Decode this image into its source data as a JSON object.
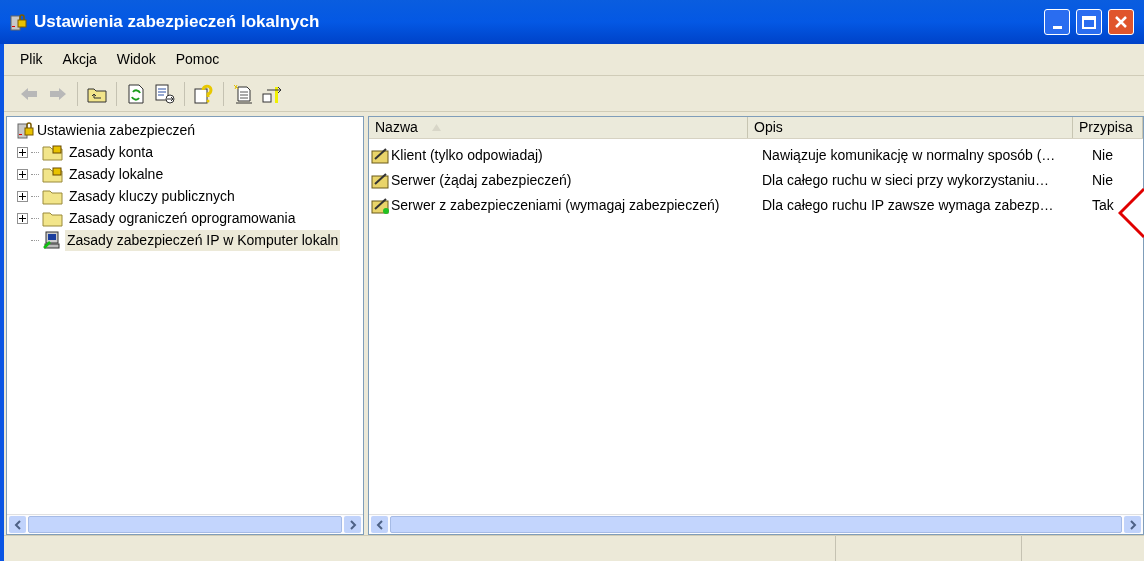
{
  "window": {
    "title": "Ustawienia zabezpieczeń lokalnych"
  },
  "menu": [
    "Plik",
    "Akcja",
    "Widok",
    "Pomoc"
  ],
  "tree": {
    "label": "Ustawienia zabezpieczeń",
    "children": [
      {
        "label": "Zasady konta",
        "kind": "locked-folder",
        "selected": false
      },
      {
        "label": "Zasady lokalne",
        "kind": "locked-folder",
        "selected": false
      },
      {
        "label": "Zasady kluczy publicznych",
        "kind": "folder",
        "selected": false
      },
      {
        "label": "Zasady ograniczeń oprogramowania",
        "kind": "folder",
        "selected": false
      },
      {
        "label": "Zasady zabezpieczeń IP w Komputer lokaln",
        "kind": "computer",
        "selected": true
      }
    ]
  },
  "table": {
    "columns": [
      {
        "label": "Nazwa",
        "sorted": true
      },
      {
        "label": "Opis",
        "sorted": false
      },
      {
        "label": "Przypisa",
        "sorted": false
      }
    ],
    "rows": [
      {
        "name": "Klient (tylko odpowiadaj)",
        "description": "Nawiązuje komunikację w normalny sposób (…",
        "assigned": "Nie",
        "active": false
      },
      {
        "name": "Serwer (żądaj zabezpieczeń)",
        "description": "Dla całego ruchu w sieci przy wykorzystaniu…",
        "assigned": "Nie",
        "active": false
      },
      {
        "name": "Serwer z zabezpieczeniami (wymagaj zabezpieczeń)",
        "description": "Dla całego ruchu IP zawsze wymaga zabezp…",
        "assigned": "Tak",
        "active": true
      }
    ]
  }
}
